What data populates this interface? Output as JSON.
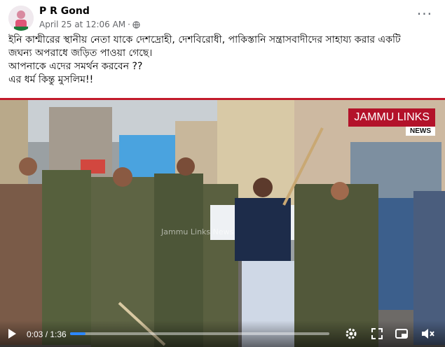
{
  "post": {
    "author": "P R Gond",
    "timestamp": "April 25 at 12:06 AM",
    "dot": "·",
    "more": "···",
    "lines": [
      "ইনি কাশ্মীরের স্থানীয় নেতা যাকে দেশদ্রোহী, দেশবিরোধী, পাকিস্তানি সন্ত্রাসবাদীদের সাহায্য করার একটি",
      "জঘন্য অপরাধে জড়িত পাওয়া গেছে।",
      "আপনাকে এদের সমর্থন করবেন ??",
      "এর ধর্ম কিন্তু মুসলিম!!"
    ]
  },
  "video": {
    "channel_logo": "JAMMU LINKS",
    "channel_sub": "NEWS",
    "watermark": "Jammu Links News",
    "time": "0:03 / 1:36",
    "progress": 0.06,
    "accent": "#2d88ff"
  }
}
